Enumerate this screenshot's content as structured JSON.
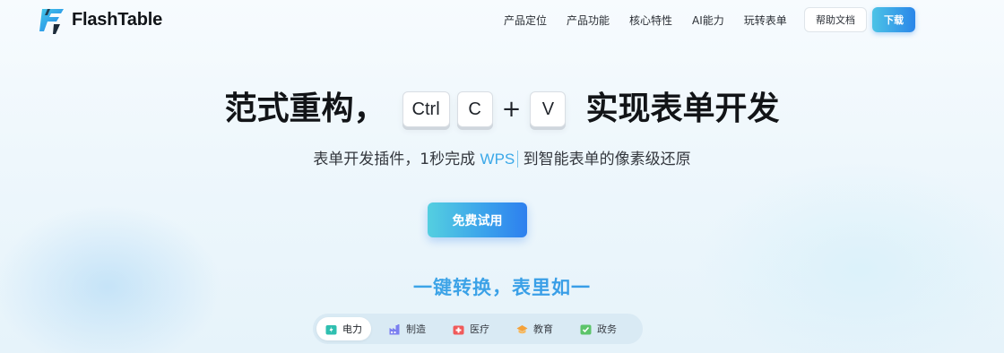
{
  "header": {
    "brand": "FlashTable",
    "nav": [
      {
        "label": "产品定位"
      },
      {
        "label": "产品功能"
      },
      {
        "label": "核心特性"
      },
      {
        "label": "AI能力"
      },
      {
        "label": "玩转表单"
      }
    ],
    "docs_label": "帮助文档",
    "download_label": "下载"
  },
  "hero": {
    "title_left": "范式重构，",
    "keys": [
      "Ctrl",
      "C",
      "+",
      "V"
    ],
    "title_right": "实现表单开发",
    "subtitle_before": "表单开发插件，1秒完成 ",
    "subtitle_highlight": "WPS",
    "subtitle_after": " 到智能表单的像素级还原",
    "cta_label": "免费试用"
  },
  "section": {
    "title": "一键转换，表里如一",
    "tabs": [
      {
        "label": "电力",
        "icon": "power-icon",
        "color": "#2fbfb0",
        "active": true
      },
      {
        "label": "制造",
        "icon": "factory-icon",
        "color": "#7b7ff0",
        "active": false
      },
      {
        "label": "医疗",
        "icon": "medical-icon",
        "color": "#f05a5a",
        "active": false
      },
      {
        "label": "教育",
        "icon": "education-icon",
        "color": "#f5a23a",
        "active": false
      },
      {
        "label": "政务",
        "icon": "government-icon",
        "color": "#5cc46a",
        "active": false
      }
    ]
  },
  "colors": {
    "accent": "#2a86e9",
    "accent_light": "#4cc3e6",
    "title_text": "#121417"
  }
}
